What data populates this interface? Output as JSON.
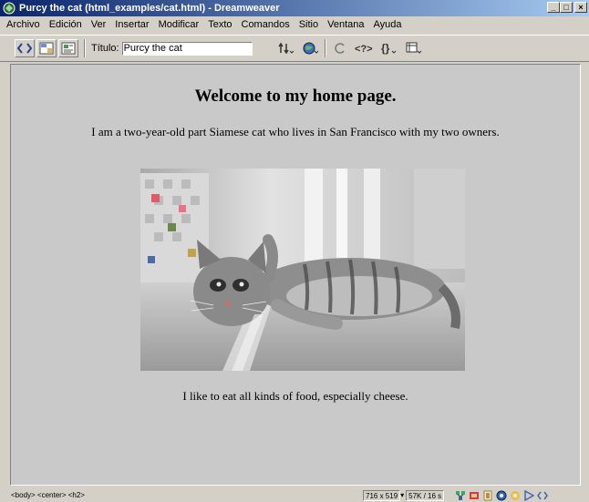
{
  "window": {
    "title": "Purcy the cat (html_examples/cat.html) - Dreamweaver",
    "minimize_label": "_",
    "maximize_label": "□",
    "close_label": "×"
  },
  "menu": {
    "items": [
      "Archivo",
      "Edición",
      "Ver",
      "Insertar",
      "Modificar",
      "Texto",
      "Comandos",
      "Sitio",
      "Ventana",
      "Ayuda"
    ]
  },
  "toolbar": {
    "title_label": "Título:",
    "title_value": "Purcy the cat",
    "buttons": [
      "code-view",
      "split-view",
      "design-view"
    ]
  },
  "document": {
    "heading": "Welcome to my home page.",
    "intro": "I am a two-year-old part Siamese cat who lives in San Francisco with my two owners.",
    "image_description": "cat-photo",
    "footer_text": "I like to eat all kinds of food, especially cheese."
  },
  "statusbar": {
    "tag_path": "<body> <center> <h2>",
    "window_size": "716 x 519",
    "download": "57K / 16 s"
  },
  "colors": {
    "titlebar_start": "#0a246a",
    "titlebar_end": "#a6caf0",
    "chrome": "#d4d0c8",
    "document_bg": "#c9c9c9"
  }
}
